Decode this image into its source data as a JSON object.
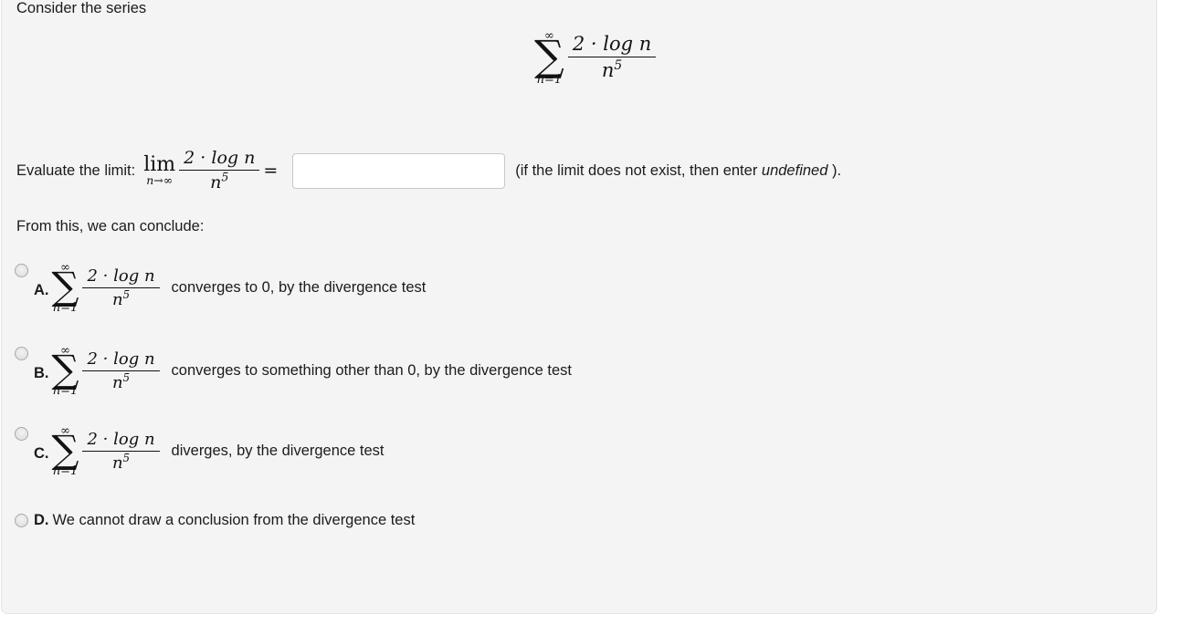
{
  "question": {
    "lead_text": "Consider the series",
    "conclude_text": "From this, we can conclude:"
  },
  "series": {
    "sum_symbol": "∑",
    "upper_limit": "∞",
    "lower_limit": "n=1",
    "numerator": "2 · log n",
    "denominator_base": "n",
    "denominator_exponent": "5"
  },
  "limit": {
    "label": "Evaluate the limit:",
    "operator": "lim",
    "variable_approach": "n→∞",
    "equals": "=",
    "input_value": "",
    "input_placeholder": "",
    "hint_before": "(if the limit does not exist, then enter ",
    "hint_italic": "undefined",
    "hint_after": " )."
  },
  "choices": [
    {
      "letter": "A.",
      "text": "converges to 0, by the divergence test",
      "has_math": true,
      "selected": false
    },
    {
      "letter": "B.",
      "text": "converges to something other than 0, by the divergence test",
      "has_math": true,
      "selected": false
    },
    {
      "letter": "C.",
      "text": "diverges, by the divergence test",
      "has_math": true,
      "selected": false
    },
    {
      "letter": "D.",
      "text": "We cannot draw a conclusion from the divergence test",
      "has_math": false,
      "selected": false
    }
  ],
  "colors": {
    "panel_background": "#f4f4f4",
    "page_background": "#ffffff",
    "text": "#1b1b1b",
    "math_text": "#121212",
    "border": "#e4e4e4",
    "input_border": "#c8c8c8",
    "radio_border": "#a9a9a9"
  }
}
